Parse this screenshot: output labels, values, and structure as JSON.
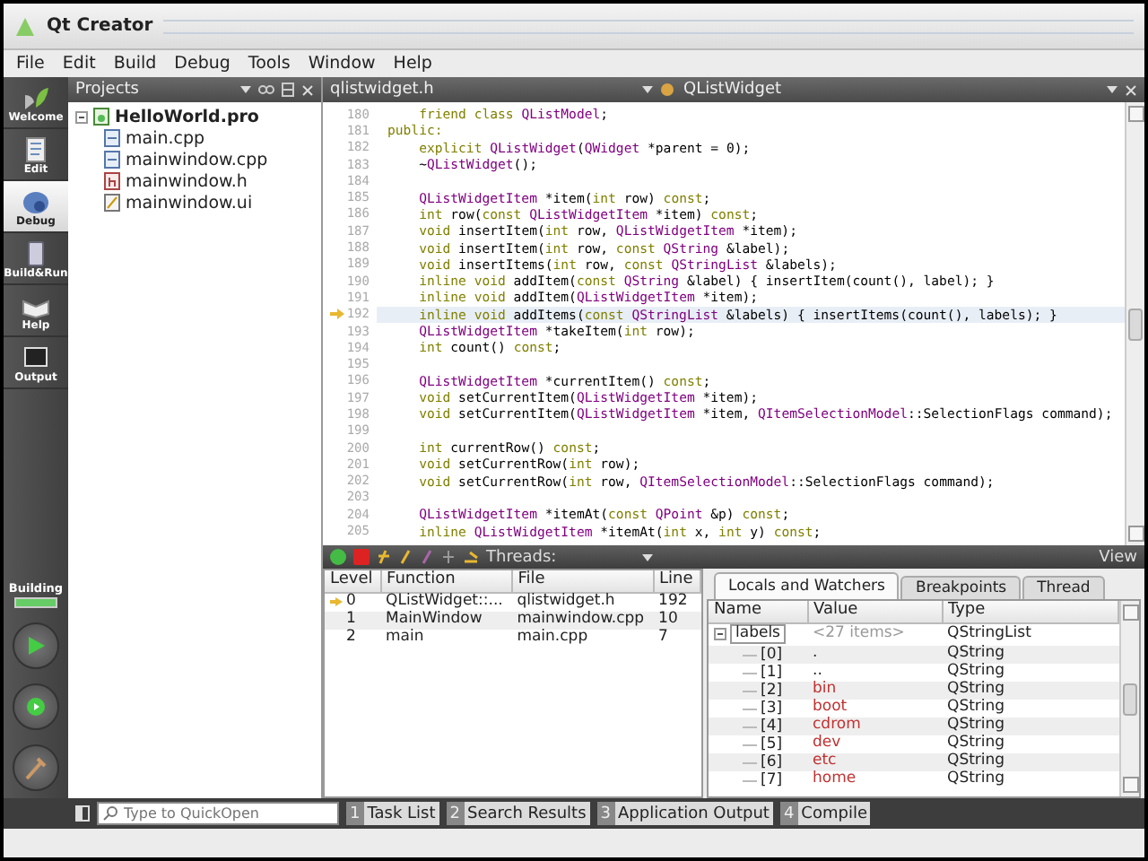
{
  "window": {
    "title": "Qt Creator"
  },
  "menu": [
    "File",
    "Edit",
    "Build",
    "Debug",
    "Tools",
    "Window",
    "Help"
  ],
  "modes": [
    {
      "label": "Welcome",
      "kind": "welcome",
      "selected": false
    },
    {
      "label": "Edit",
      "kind": "edit",
      "selected": false
    },
    {
      "label": "Debug",
      "kind": "debug",
      "selected": true
    },
    {
      "label": "Build&Run",
      "kind": "build",
      "selected": false
    },
    {
      "label": "Help",
      "kind": "help",
      "selected": false
    },
    {
      "label": "Output",
      "kind": "output",
      "selected": false
    }
  ],
  "build_status": {
    "label": "Building",
    "level": 1
  },
  "projects": {
    "title": "Projects",
    "tree": [
      {
        "name": "HelloWorld.pro",
        "kind": "project",
        "expanded": true,
        "children": [
          {
            "name": "main.cpp",
            "kind": "source"
          },
          {
            "name": "mainwindow.cpp",
            "kind": "source"
          },
          {
            "name": "mainwindow.h",
            "kind": "header"
          },
          {
            "name": "mainwindow.ui",
            "kind": "form"
          }
        ]
      }
    ]
  },
  "editor": {
    "file": "qlistwidget.h",
    "symbol": "QListWidget",
    "lines": [
      {
        "number": "180",
        "current": false,
        "tokens": [
          {
            "text": "    friend class ",
            "kind": "keyword"
          },
          {
            "text": "QListModel",
            "kind": "type"
          },
          {
            "text": ";",
            "kind": "plain"
          }
        ]
      },
      {
        "number": "181",
        "current": false,
        "tokens": [
          {
            "text": "public:",
            "kind": "keyword"
          }
        ]
      },
      {
        "number": "182",
        "current": false,
        "tokens": [
          {
            "text": "    explicit ",
            "kind": "keyword"
          },
          {
            "text": "QListWidget",
            "kind": "type"
          },
          {
            "text": "(",
            "kind": "plain"
          },
          {
            "text": "QWidget",
            "kind": "type"
          },
          {
            "text": " *parent = 0);",
            "kind": "plain"
          }
        ]
      },
      {
        "number": "183",
        "current": false,
        "tokens": [
          {
            "text": "    ~",
            "kind": "plain"
          },
          {
            "text": "QListWidget",
            "kind": "type"
          },
          {
            "text": "();",
            "kind": "plain"
          }
        ]
      },
      {
        "number": "184",
        "current": false
      },
      {
        "number": "185",
        "current": false,
        "tokens": [
          {
            "text": "    QListWidgetItem",
            "kind": "type"
          },
          {
            "text": " *item(",
            "kind": "plain"
          },
          {
            "text": "int",
            "kind": "keyword"
          },
          {
            "text": " row) ",
            "kind": "plain"
          },
          {
            "text": "const",
            "kind": "keyword"
          },
          {
            "text": ";",
            "kind": "plain"
          }
        ]
      },
      {
        "number": "186",
        "current": false,
        "tokens": [
          {
            "text": "    int",
            "kind": "keyword"
          },
          {
            "text": " row(",
            "kind": "plain"
          },
          {
            "text": "const ",
            "kind": "keyword"
          },
          {
            "text": "QListWidgetItem",
            "kind": "type"
          },
          {
            "text": " *item) ",
            "kind": "plain"
          },
          {
            "text": "const",
            "kind": "keyword"
          },
          {
            "text": ";",
            "kind": "plain"
          }
        ]
      },
      {
        "number": "187",
        "current": false,
        "tokens": [
          {
            "text": "    void",
            "kind": "keyword"
          },
          {
            "text": " insertItem(",
            "kind": "plain"
          },
          {
            "text": "int",
            "kind": "keyword"
          },
          {
            "text": " row, ",
            "kind": "plain"
          },
          {
            "text": "QListWidgetItem",
            "kind": "type"
          },
          {
            "text": " *item);",
            "kind": "plain"
          }
        ]
      },
      {
        "number": "188",
        "current": false,
        "tokens": [
          {
            "text": "    void",
            "kind": "keyword"
          },
          {
            "text": " insertItem(",
            "kind": "plain"
          },
          {
            "text": "int",
            "kind": "keyword"
          },
          {
            "text": " row, ",
            "kind": "plain"
          },
          {
            "text": "const ",
            "kind": "keyword"
          },
          {
            "text": "QString",
            "kind": "type"
          },
          {
            "text": " &label);",
            "kind": "plain"
          }
        ]
      },
      {
        "number": "189",
        "current": false,
        "tokens": [
          {
            "text": "    void",
            "kind": "keyword"
          },
          {
            "text": " insertItems(",
            "kind": "plain"
          },
          {
            "text": "int",
            "kind": "keyword"
          },
          {
            "text": " row, ",
            "kind": "plain"
          },
          {
            "text": "const ",
            "kind": "keyword"
          },
          {
            "text": "QStringList",
            "kind": "type"
          },
          {
            "text": " &labels);",
            "kind": "plain"
          }
        ]
      },
      {
        "number": "190",
        "current": false,
        "tokens": [
          {
            "text": "    inline void",
            "kind": "keyword"
          },
          {
            "text": " addItem(",
            "kind": "plain"
          },
          {
            "text": "const ",
            "kind": "keyword"
          },
          {
            "text": "QString",
            "kind": "type"
          },
          {
            "text": " &label) { insertItem(count(), label); }",
            "kind": "plain"
          }
        ]
      },
      {
        "number": "191",
        "current": false,
        "tokens": [
          {
            "text": "    inline void",
            "kind": "keyword"
          },
          {
            "text": " addItem(",
            "kind": "plain"
          },
          {
            "text": "QListWidgetItem",
            "kind": "type"
          },
          {
            "text": " *item);",
            "kind": "plain"
          }
        ]
      },
      {
        "number": "192",
        "current": true,
        "tokens": [
          {
            "text": "    inline void",
            "kind": "keyword"
          },
          {
            "text": " addItems(",
            "kind": "plain"
          },
          {
            "text": "const ",
            "kind": "keyword"
          },
          {
            "text": "QStringList",
            "kind": "type"
          },
          {
            "text": " &labels) { insertItems(count(), labels); }",
            "kind": "plain"
          }
        ]
      },
      {
        "number": "193",
        "current": false,
        "tokens": [
          {
            "text": "    QListWidgetItem",
            "kind": "type"
          },
          {
            "text": " *takeItem(",
            "kind": "plain"
          },
          {
            "text": "int",
            "kind": "keyword"
          },
          {
            "text": " row);",
            "kind": "plain"
          }
        ]
      },
      {
        "number": "194",
        "current": false,
        "tokens": [
          {
            "text": "    int",
            "kind": "keyword"
          },
          {
            "text": " count() ",
            "kind": "plain"
          },
          {
            "text": "const",
            "kind": "keyword"
          },
          {
            "text": ";",
            "kind": "plain"
          }
        ]
      },
      {
        "number": "195",
        "current": false
      },
      {
        "number": "196",
        "current": false,
        "tokens": [
          {
            "text": "    QListWidgetItem",
            "kind": "type"
          },
          {
            "text": " *currentItem() ",
            "kind": "plain"
          },
          {
            "text": "const",
            "kind": "keyword"
          },
          {
            "text": ";",
            "kind": "plain"
          }
        ]
      },
      {
        "number": "197",
        "current": false,
        "tokens": [
          {
            "text": "    void",
            "kind": "keyword"
          },
          {
            "text": " setCurrentItem(",
            "kind": "plain"
          },
          {
            "text": "QListWidgetItem",
            "kind": "type"
          },
          {
            "text": " *item);",
            "kind": "plain"
          }
        ]
      },
      {
        "number": "198",
        "current": false,
        "tokens": [
          {
            "text": "    void",
            "kind": "keyword"
          },
          {
            "text": " setCurrentItem(",
            "kind": "plain"
          },
          {
            "text": "QListWidgetItem",
            "kind": "type"
          },
          {
            "text": " *item, ",
            "kind": "plain"
          },
          {
            "text": "QItemSelectionModel",
            "kind": "type"
          },
          {
            "text": "::SelectionFlags command);",
            "kind": "plain"
          }
        ]
      },
      {
        "number": "199",
        "current": false
      },
      {
        "number": "200",
        "current": false,
        "tokens": [
          {
            "text": "    int",
            "kind": "keyword"
          },
          {
            "text": " currentRow() ",
            "kind": "plain"
          },
          {
            "text": "const",
            "kind": "keyword"
          },
          {
            "text": ";",
            "kind": "plain"
          }
        ]
      },
      {
        "number": "201",
        "current": false,
        "tokens": [
          {
            "text": "    void",
            "kind": "keyword"
          },
          {
            "text": " setCurrentRow(",
            "kind": "plain"
          },
          {
            "text": "int",
            "kind": "keyword"
          },
          {
            "text": " row);",
            "kind": "plain"
          }
        ]
      },
      {
        "number": "202",
        "current": false,
        "tokens": [
          {
            "text": "    void",
            "kind": "keyword"
          },
          {
            "text": " setCurrentRow(",
            "kind": "plain"
          },
          {
            "text": "int",
            "kind": "keyword"
          },
          {
            "text": " row, ",
            "kind": "plain"
          },
          {
            "text": "QItemSelectionModel",
            "kind": "type"
          },
          {
            "text": "::SelectionFlags command);",
            "kind": "plain"
          }
        ]
      },
      {
        "number": "203",
        "current": false
      },
      {
        "number": "204",
        "current": false,
        "tokens": [
          {
            "text": "    QListWidgetItem",
            "kind": "type"
          },
          {
            "text": " *itemAt(",
            "kind": "plain"
          },
          {
            "text": "const ",
            "kind": "keyword"
          },
          {
            "text": "QPoint",
            "kind": "type"
          },
          {
            "text": " &p) ",
            "kind": "plain"
          },
          {
            "text": "const",
            "kind": "keyword"
          },
          {
            "text": ";",
            "kind": "plain"
          }
        ]
      },
      {
        "number": "205",
        "current": false,
        "tokens": [
          {
            "text": "    inline ",
            "kind": "keyword"
          },
          {
            "text": "QListWidgetItem",
            "kind": "type"
          },
          {
            "text": " *itemAt(",
            "kind": "plain"
          },
          {
            "text": "int",
            "kind": "keyword"
          },
          {
            "text": " x, ",
            "kind": "plain"
          },
          {
            "text": "int",
            "kind": "keyword"
          },
          {
            "text": " y) ",
            "kind": "plain"
          },
          {
            "text": "const",
            "kind": "keyword"
          },
          {
            "text": ";",
            "kind": "plain"
          }
        ]
      }
    ]
  },
  "debug_toolbar": {
    "threads_label": "Threads:",
    "view_button": "View"
  },
  "stack": {
    "columns": [
      "Level",
      "Function",
      "File",
      "Line"
    ],
    "rows": [
      {
        "level": "0",
        "function": "QListWidget::...",
        "file": "qlistwidget.h",
        "line": "192",
        "current": true
      },
      {
        "level": "1",
        "function": "MainWindow",
        "file": "mainwindow.cpp",
        "line": "10",
        "current": false
      },
      {
        "level": "2",
        "function": "main",
        "file": "main.cpp",
        "line": "7",
        "current": false
      }
    ]
  },
  "locals": {
    "tabs": [
      {
        "label": "Locals and Watchers",
        "selected": true
      },
      {
        "label": "Breakpoints",
        "selected": false
      },
      {
        "label": "Thread",
        "selected": false
      }
    ],
    "columns": [
      "Name",
      "Value",
      "Type"
    ],
    "rows": [
      {
        "name": "labels",
        "value": "<27 items>",
        "type": "QStringList",
        "expanded": true,
        "children": [
          {
            "name": "[0]",
            "value": ".",
            "type": "QString",
            "changed": false
          },
          {
            "name": "[1]",
            "value": "..",
            "type": "QString",
            "changed": false
          },
          {
            "name": "[2]",
            "value": "bin",
            "type": "QString",
            "changed": true
          },
          {
            "name": "[3]",
            "value": "boot",
            "type": "QString",
            "changed": true
          },
          {
            "name": "[4]",
            "value": "cdrom",
            "type": "QString",
            "changed": true
          },
          {
            "name": "[5]",
            "value": "dev",
            "type": "QString",
            "changed": true
          },
          {
            "name": "[6]",
            "value": "etc",
            "type": "QString",
            "changed": true
          },
          {
            "name": "[7]",
            "value": "home",
            "type": "QString",
            "changed": true
          }
        ]
      }
    ]
  },
  "status_bar": {
    "search": {
      "placeholder": "Type to QuickOpen"
    },
    "panes": [
      {
        "number": "1",
        "label": "Task List"
      },
      {
        "number": "2",
        "label": "Search Results"
      },
      {
        "number": "3",
        "label": "Application Output"
      },
      {
        "number": "4",
        "label": "Compile"
      }
    ]
  }
}
